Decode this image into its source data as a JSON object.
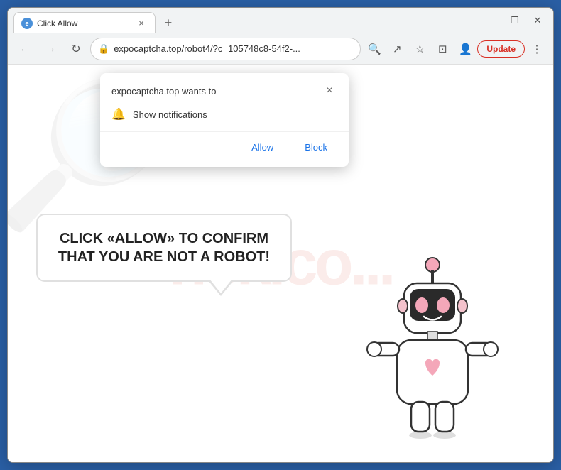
{
  "browser": {
    "title_bar": {
      "tab_title": "Click Allow",
      "favicon_text": "e",
      "close_symbol": "×",
      "new_tab_symbol": "+",
      "window_btn_minimize": "—",
      "window_btn_maximize": "❐",
      "window_btn_close": "✕",
      "window_btn_restore": "❐"
    },
    "toolbar": {
      "back_symbol": "←",
      "forward_symbol": "→",
      "reload_symbol": "↻",
      "address": "expocaptcha.top/robot4/?c=105748c8-54f2-...",
      "lock_symbol": "🔒",
      "search_symbol": "🔍",
      "share_symbol": "↗",
      "bookmark_symbol": "☆",
      "split_symbol": "⊡",
      "profile_symbol": "👤",
      "update_label": "Update",
      "menu_symbol": "⋮"
    }
  },
  "notification_popup": {
    "title": "expocaptcha.top wants to",
    "close_symbol": "×",
    "bell_symbol": "🔔",
    "notification_label": "Show notifications",
    "allow_label": "Allow",
    "block_label": "Block"
  },
  "main_content": {
    "message": "CLICK «ALLOW» TO CONFIRM THAT YOU ARE NOT A ROBOT!",
    "watermark": "risk.co..."
  }
}
